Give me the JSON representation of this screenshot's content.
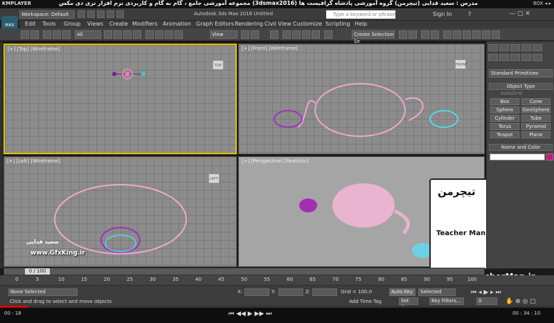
{
  "player": {
    "logo": "KMPLAYER",
    "course_title": "مجموعه آموزشی جامع ، گام به گام و کاربردی نرم افزار تری دی مکس (3dsmax2016)  مدرس : سعید فدایی (تیچرمن) گروه آموزشی پادشاه گرافیست ها",
    "right_text": "BOX ◂ ▸"
  },
  "titlebar": {
    "workspace": "Workspace: Default",
    "app_title": "Autodesk 3ds Max 2016    Untitled",
    "search_placeholder": "Type a keyword or phrase",
    "signin": "Sign In",
    "help": "?"
  },
  "app_logo": "MAX",
  "menu": [
    "Edit",
    "Tools",
    "Group",
    "Views",
    "Create",
    "Modifiers",
    "Animation",
    "Graph Editors",
    "Rendering",
    "Civil View",
    "Customize",
    "Scripting",
    "Help"
  ],
  "toolbar": {
    "filter_select": "All",
    "view_select": "View",
    "selection_set": "Create Selection Se"
  },
  "viewports": {
    "top": "[+] [Top] [Wireframe]",
    "front": "[+] [Front] [Wireframe]",
    "left": "[+] [Left] [Wireframe]",
    "perspective": "[+] [Perspective] [Realistic]",
    "cube_top": "TOP",
    "cube_front": "FRONT",
    "cube_left": "LEFT"
  },
  "command_panel": {
    "dropdown": "Standard Primitives",
    "object_type": "Object Type",
    "autogrid": "AutoGrid",
    "buttons": [
      "Box",
      "Cone",
      "Sphere",
      "GeoSphere",
      "Cylinder",
      "Tube",
      "Torus",
      "Pyramid",
      "Teapot",
      "Plane"
    ],
    "name_color": "Name and Color",
    "object_color": "#d70d7c"
  },
  "timeline": {
    "frame": "0 / 100",
    "ticks": [
      "0",
      "5",
      "10",
      "15",
      "20",
      "25",
      "30",
      "35",
      "40",
      "45",
      "50",
      "55",
      "60",
      "65",
      "70",
      "75",
      "80",
      "85",
      "90",
      "95",
      "100"
    ]
  },
  "status": {
    "selection": "None Selected",
    "prompt": "Click and drag to select and move objects",
    "x_label": "X:",
    "y_label": "Y:",
    "z_label": "Z:",
    "grid": "Grid = 100.0",
    "add_time_tag": "Add Time Tag",
    "auto_key": "Auto Key",
    "set_key": "Set Key",
    "key_mode": "Selected",
    "key_filters": "Key Filters...",
    "frame_field": "0"
  },
  "player_bottom": {
    "time_left": "00 : 18",
    "time_right": "00 : 34 : 10",
    "progress_percent": 5
  },
  "watermarks": {
    "gfxking": "www.GfxKing.ir",
    "author": "سعید فدایی",
    "teacherman_farsi": "تیچرمن",
    "teacherman_en": "Teacher Man",
    "teacherman_url": "www.TeacherMan.ir"
  }
}
